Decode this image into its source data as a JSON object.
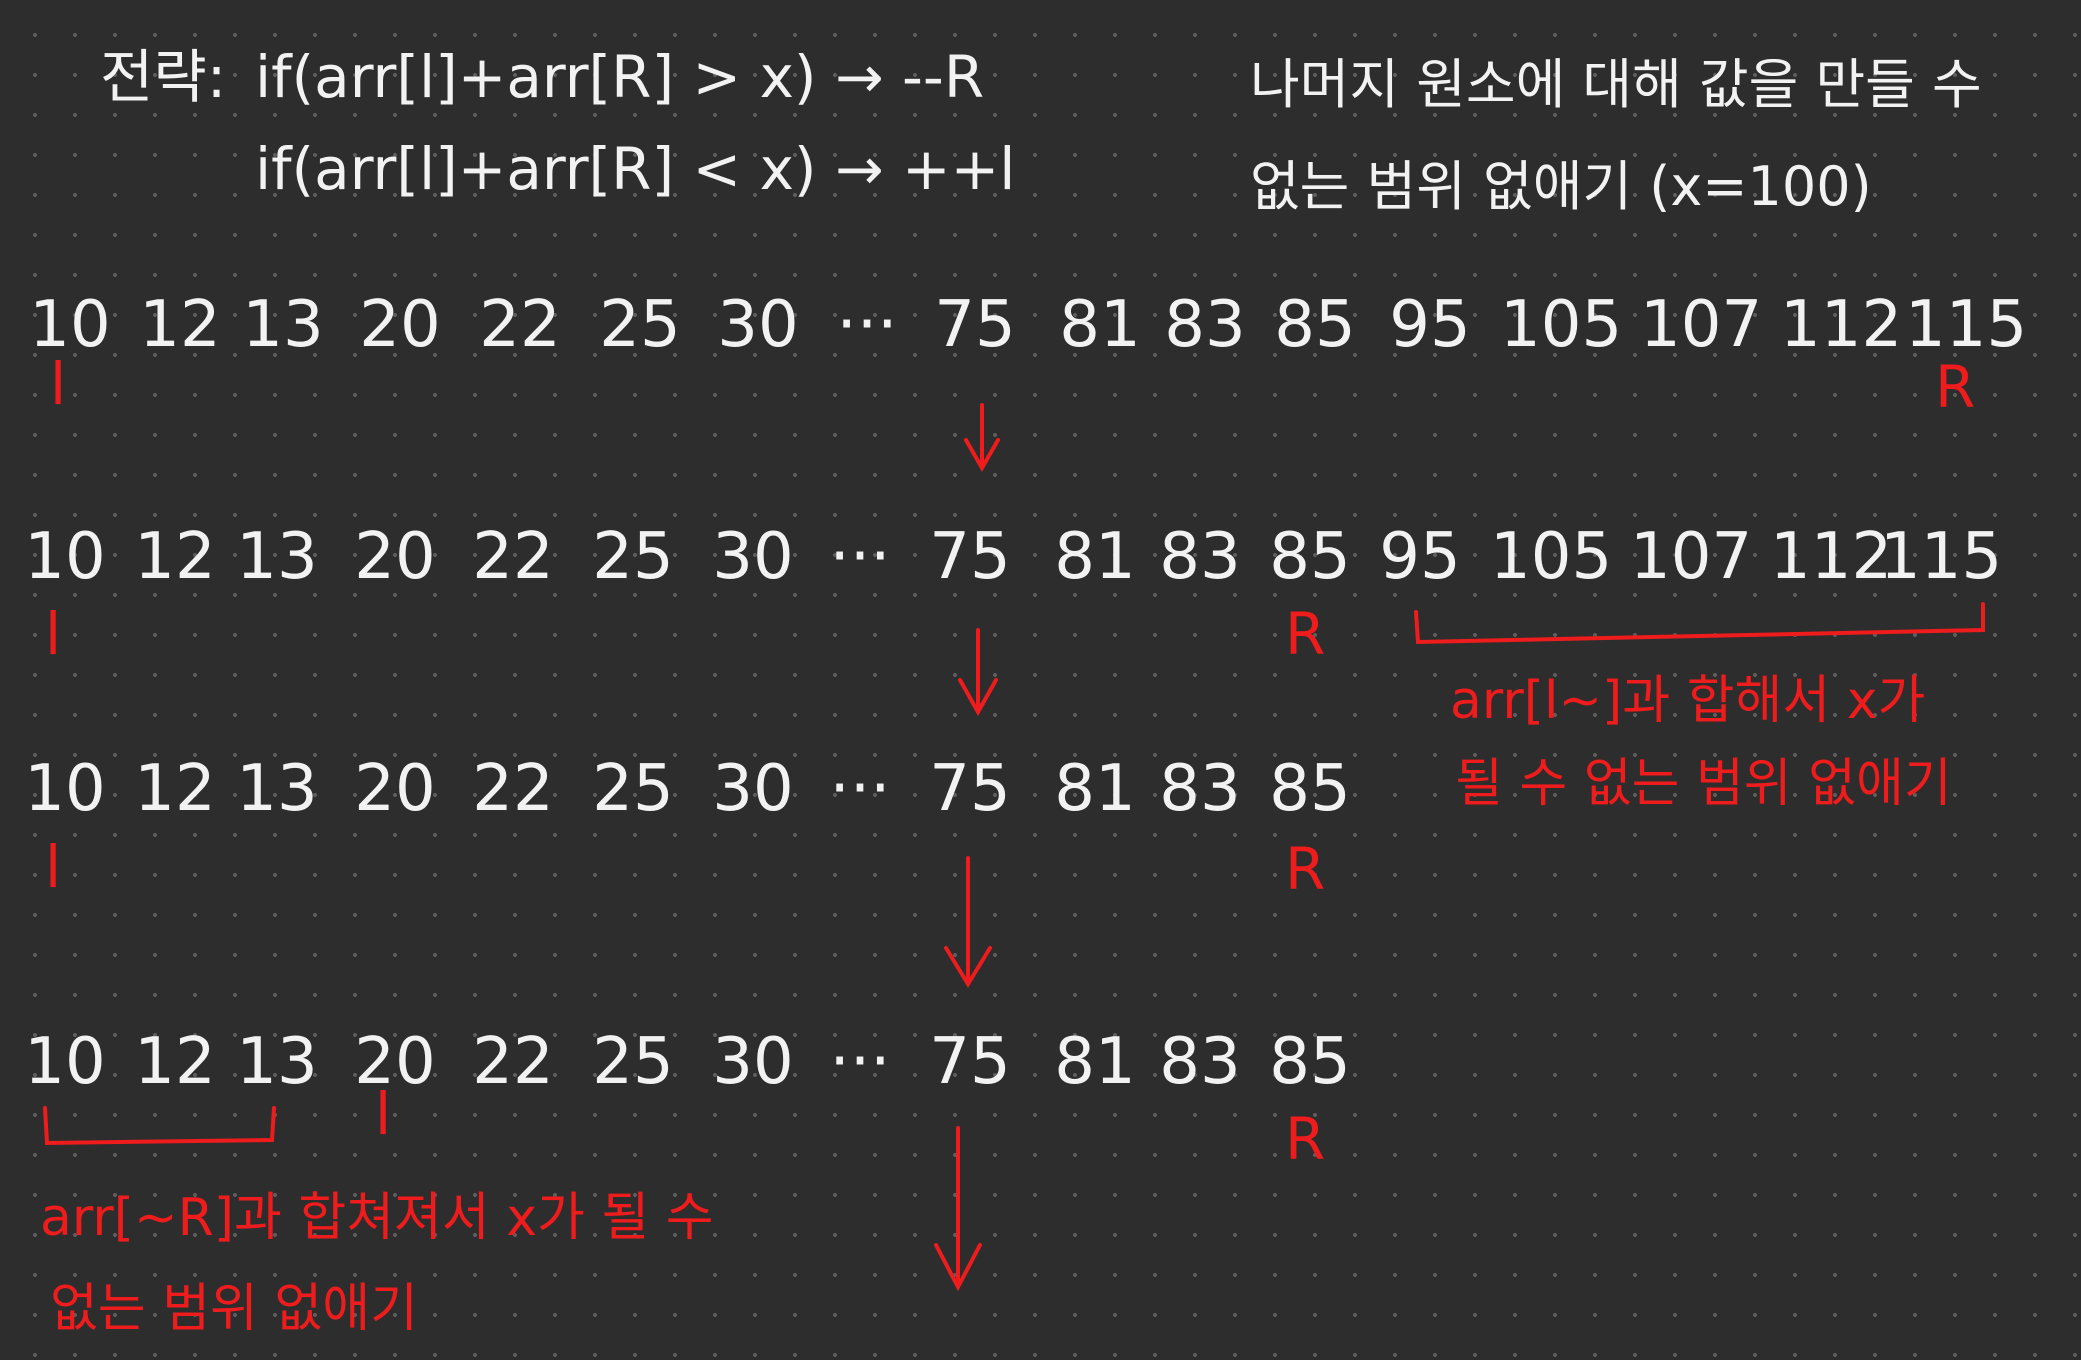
{
  "strategy": {
    "label": "전략:",
    "rule1": "if(arr[l]+arr[R] > x) → --R",
    "rule2": "if(arr[l]+arr[R] < x) → ++l"
  },
  "note": {
    "line1": "나머지 원소에 대해 값을 만들 수",
    "line2": "없는 범위 없애기 (x=100)"
  },
  "rows": [
    {
      "numbers": [
        "10",
        "12",
        "13",
        "20",
        "22",
        "25",
        "30",
        "···",
        "75",
        "81",
        "83",
        "85",
        "95",
        "105",
        "107",
        "112",
        "115"
      ],
      "l_label": "l",
      "r_label": "R"
    },
    {
      "numbers": [
        "10",
        "12",
        "13",
        "20",
        "22",
        "25",
        "30",
        "···",
        "75",
        "81",
        "83",
        "85",
        "95",
        "105",
        "107",
        "112",
        "115"
      ],
      "l_label": "l",
      "r_label": "R"
    },
    {
      "numbers": [
        "10",
        "12",
        "13",
        "20",
        "22",
        "25",
        "30",
        "···",
        "75",
        "81",
        "83",
        "85"
      ],
      "l_label": "l",
      "r_label": "R"
    },
    {
      "numbers": [
        "10",
        "12",
        "13",
        "20",
        "22",
        "25",
        "30",
        "···",
        "75",
        "81",
        "83",
        "85"
      ],
      "l_label": "l",
      "r_label": "R"
    }
  ],
  "annotations": {
    "right": {
      "line1": "arr[l~]과 합해서 x가",
      "line2": "될 수 없는 범위 없애기"
    },
    "left": {
      "line1": "arr[~R]과 합쳐져서 x가 될 수",
      "line2": "없는 범위 없애기"
    }
  },
  "colors": {
    "background": "#2d2d2d",
    "ink": "#f2f2f2",
    "annotation": "#ee1c1c"
  }
}
